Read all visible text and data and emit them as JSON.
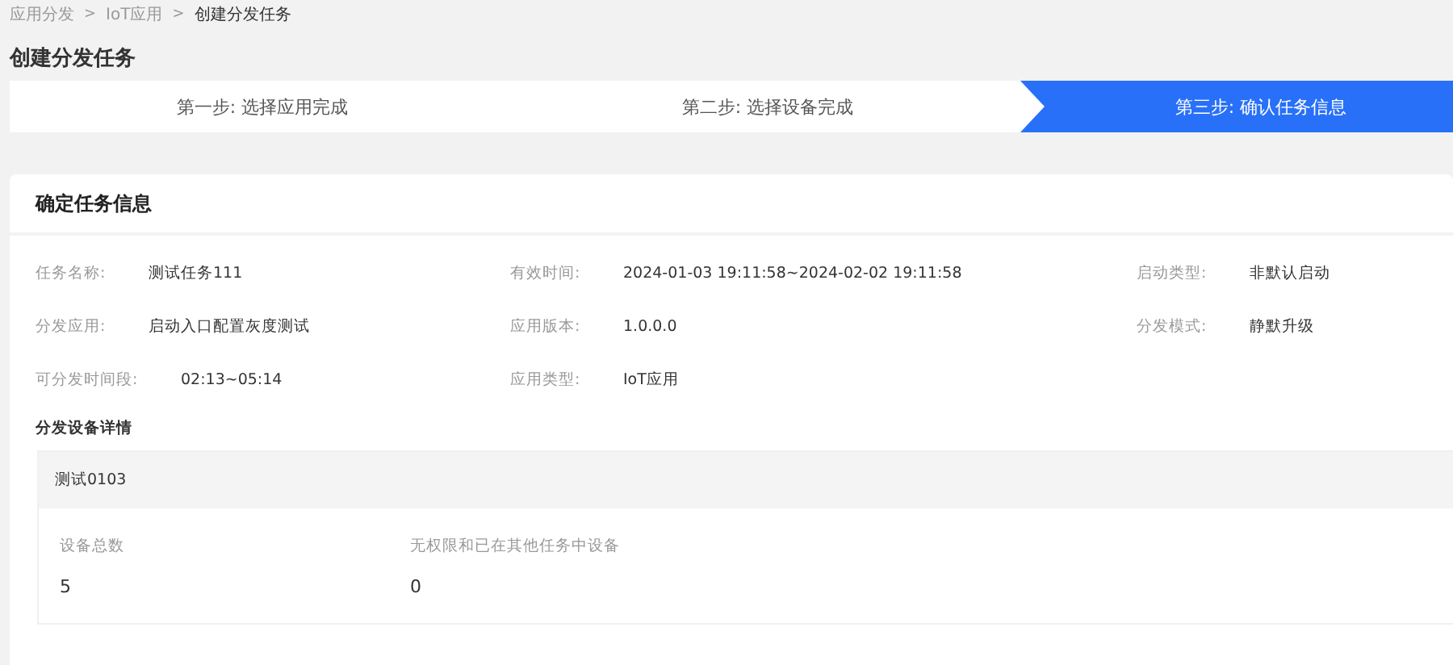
{
  "breadcrumb": [
    {
      "label": "应用分发",
      "current": false
    },
    {
      "label": "IoT应用",
      "current": false
    },
    {
      "label": "创建分发任务",
      "current": true
    }
  ],
  "breadcrumb_separator": ">",
  "page_title": "创建分发任务",
  "steps": [
    {
      "label": "第一步: 选择应用完成",
      "selected": false
    },
    {
      "label": "第二步: 选择设备完成",
      "selected": false
    },
    {
      "label": "第三步: 确认任务信息",
      "selected": true
    }
  ],
  "card": {
    "title": "确定任务信息",
    "fields": [
      {
        "label": "任务名称:",
        "value": "测试任务111"
      },
      {
        "label": "有效时间:",
        "value": "2024-01-03 19:11:58~2024-02-02 19:11:58"
      },
      {
        "label": "启动类型:",
        "value": "非默认启动"
      },
      {
        "label": "分发应用:",
        "value": "启动入口配置灰度测试"
      },
      {
        "label": "应用版本:",
        "value": "1.0.0.0"
      },
      {
        "label": "分发模式:",
        "value": "静默升级"
      },
      {
        "label": "可分发时间段:",
        "value": "02:13~05:14"
      },
      {
        "label": "应用类型:",
        "value": "IoT应用"
      }
    ],
    "section_title": "分发设备详情",
    "device_group": {
      "name": "测试0103",
      "stats": [
        {
          "label": "设备总数",
          "value": "5"
        },
        {
          "label": "无权限和已在其他任务中设备",
          "value": "0"
        }
      ]
    }
  }
}
